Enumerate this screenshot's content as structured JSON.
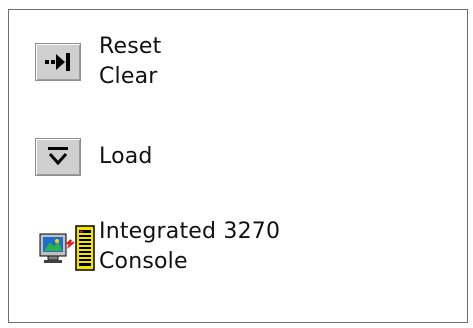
{
  "items": [
    {
      "icon": "reset-clear-icon",
      "lines": [
        "Reset",
        "Clear"
      ]
    },
    {
      "icon": "load-icon",
      "lines": [
        "Load"
      ]
    },
    {
      "icon": "integrated-3270-console-icon",
      "lines": [
        "Integrated 3270",
        "Console"
      ]
    }
  ]
}
